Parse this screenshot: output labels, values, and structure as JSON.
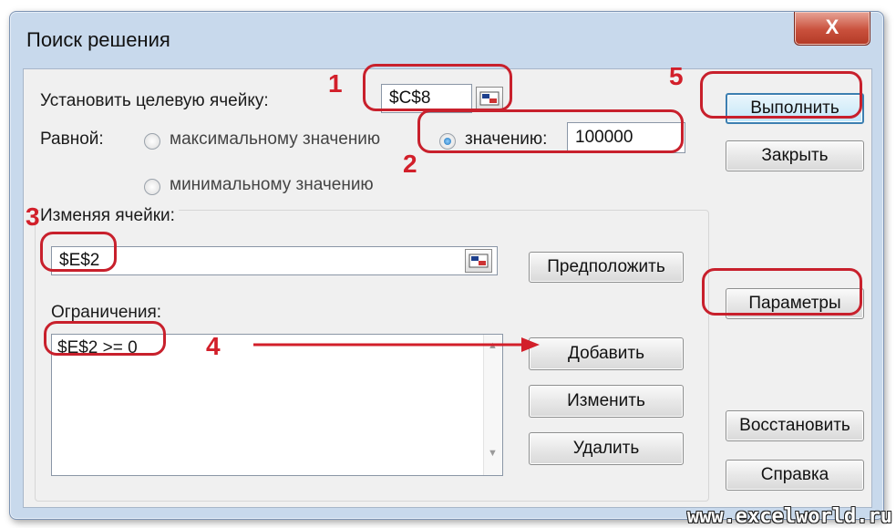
{
  "window": {
    "title": "Поиск решения",
    "close_label": "X"
  },
  "target": {
    "label": "Установить целевую ячейку:",
    "value": "$C$8"
  },
  "equal": {
    "label": "Равной:",
    "options": [
      {
        "label": "максимальному значению",
        "selected": false
      },
      {
        "label": "минимальному значению",
        "selected": false
      },
      {
        "label": "значению:",
        "selected": true
      }
    ],
    "value": "100000"
  },
  "changing": {
    "label": "Изменяя ячейки:",
    "value": "$E$2",
    "guess_button": "Предположить"
  },
  "constraints": {
    "label": "Ограничения:",
    "items": [
      "$E$2 >= 0"
    ],
    "add_button": "Добавить",
    "change_button": "Изменить",
    "delete_button": "Удалить"
  },
  "buttons": {
    "run": "Выполнить",
    "close": "Закрыть",
    "options": "Параметры",
    "reset": "Восстановить",
    "help": "Справка"
  },
  "annotations": [
    "1",
    "2",
    "3",
    "4",
    "5"
  ],
  "watermark": "www.excelworld.ru",
  "colors": {
    "annotation": "#d21f2a",
    "window_frame": "#c8d9ec"
  }
}
